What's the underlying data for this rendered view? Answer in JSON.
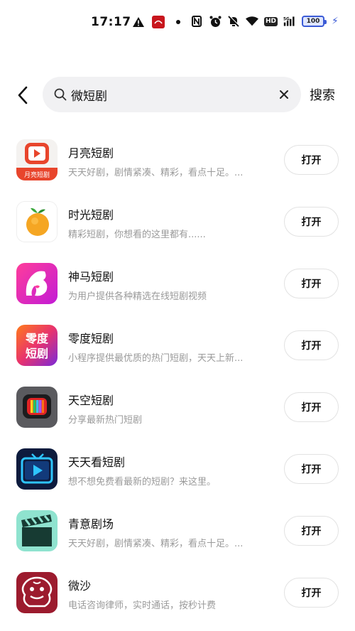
{
  "status_bar": {
    "time": "17:17",
    "network": "5G",
    "battery": "100"
  },
  "search": {
    "query": "微短剧",
    "placeholder": "",
    "submit_label": "搜索"
  },
  "results": [
    {
      "name": "月亮短剧",
      "desc": "天天好剧，剧情紧凑、精彩，看点十足。...",
      "button": "打开",
      "icon": "moon-drama-icon",
      "icon_text": "月亮短剧"
    },
    {
      "name": "时光短剧",
      "desc": "精彩短剧，你想看的这里都有......",
      "button": "打开",
      "icon": "orange-icon"
    },
    {
      "name": "神马短剧",
      "desc": "为用户提供各种精选在线短剧视频",
      "button": "打开",
      "icon": "horse-icon"
    },
    {
      "name": "零度短剧",
      "desc": "小程序提供最优质的热门短剧，天天上新...",
      "button": "打开",
      "icon": "lingdu-icon",
      "icon_text_top": "零度",
      "icon_text_bottom": "短剧"
    },
    {
      "name": "天空短剧",
      "desc": "分享最新热门短剧",
      "button": "打开",
      "icon": "tv-color-icon"
    },
    {
      "name": "天天看短剧",
      "desc": "想不想免费看最新的短剧？来这里。",
      "button": "打开",
      "icon": "tv-play-icon"
    },
    {
      "name": "青意剧场",
      "desc": "天天好剧，剧情紧凑、精彩，看点十足。...",
      "button": "打开",
      "icon": "clapperboard-icon"
    },
    {
      "name": "微沙",
      "desc": "电话咨询律师，实时通话，按秒计费",
      "button": "打开",
      "icon": "lion-icon"
    }
  ],
  "colors": {
    "search_bg": "#f1f1f3",
    "secondary_text": "#9a9a9a",
    "battery_accent": "#3b5bd6"
  }
}
